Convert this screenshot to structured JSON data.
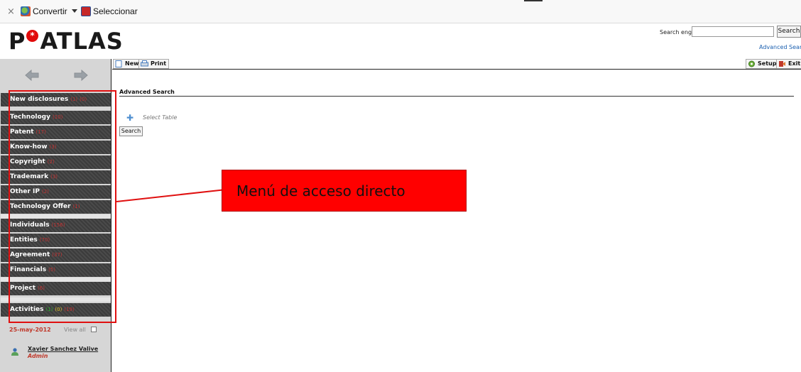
{
  "browser_toolbar": {
    "close_glyph": "×",
    "convert_label": "Convertir",
    "select_label": "Seleccionar"
  },
  "header": {
    "logo_left": "P",
    "logo_right": "ATLAS",
    "logo_star": "*",
    "search_label": "Search engine",
    "search_value": "",
    "search_button": "Search",
    "advanced_link": "Advanced Search"
  },
  "sidebar": {
    "menu": [
      {
        "label": "New disclosures",
        "counts": [
          {
            "text": "(1)",
            "tone": "r"
          },
          {
            "text": "(0)",
            "tone": "r"
          }
        ]
      },
      {
        "label": "Technology",
        "counts": [
          {
            "text": "(10)",
            "tone": "r"
          }
        ]
      },
      {
        "label": "Patent",
        "counts": [
          {
            "text": "(17)",
            "tone": "r"
          }
        ]
      },
      {
        "label": "Know-how",
        "counts": [
          {
            "text": "(3)",
            "tone": "r"
          }
        ]
      },
      {
        "label": "Copyright",
        "counts": [
          {
            "text": "(2)",
            "tone": "r"
          }
        ]
      },
      {
        "label": "Trademark",
        "counts": [
          {
            "text": "(3)",
            "tone": "r"
          }
        ]
      },
      {
        "label": "Other IP",
        "counts": [
          {
            "text": "(2)",
            "tone": "r"
          }
        ]
      },
      {
        "label": "Technology Offer",
        "counts": [
          {
            "text": "(1)",
            "tone": "r"
          }
        ]
      },
      {
        "label": "Individuals",
        "counts": [
          {
            "text": "(156)",
            "tone": "r"
          }
        ]
      },
      {
        "label": "Entities",
        "counts": [
          {
            "text": "(70)",
            "tone": "r"
          }
        ]
      },
      {
        "label": "Agreement",
        "counts": [
          {
            "text": "(37)",
            "tone": "r"
          }
        ]
      },
      {
        "label": "Financials",
        "counts": [
          {
            "text": "(5)",
            "tone": "r"
          }
        ]
      },
      {
        "label": "Project",
        "counts": [
          {
            "text": "(6)",
            "tone": "r"
          }
        ]
      },
      {
        "label": "Activities",
        "counts": [
          {
            "text": "(1)",
            "tone": "g"
          },
          {
            "text": "(0)",
            "tone": "y"
          },
          {
            "text": "(19)",
            "tone": "r"
          }
        ]
      }
    ],
    "date": "25-may-2012",
    "view_all": "View all",
    "user_name": "Xavier Sanchez Valive",
    "user_role": "Admin"
  },
  "toolbar": {
    "new_label": "New",
    "print_label": "Print",
    "setup_label": "Setup",
    "exit_label": "Exit"
  },
  "main": {
    "title": "Advanced Search",
    "select_table": "Select Table",
    "search_button": "Search"
  },
  "annotation": {
    "callout_text": "Menú de acceso directo",
    "color": "#ff0000"
  }
}
